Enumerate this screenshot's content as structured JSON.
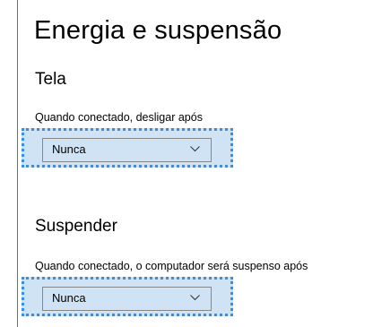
{
  "page": {
    "title": "Energia e suspensão"
  },
  "screen": {
    "heading": "Tela",
    "label": "Quando conectado, desligar após",
    "selected": "Nunca"
  },
  "sleep": {
    "heading": "Suspender",
    "label": "Quando conectado, o computador será suspenso após",
    "selected": "Nunca"
  },
  "colors": {
    "accent_focus": "#3a8ee0",
    "dropdown_fill": "#cfe3f5"
  }
}
